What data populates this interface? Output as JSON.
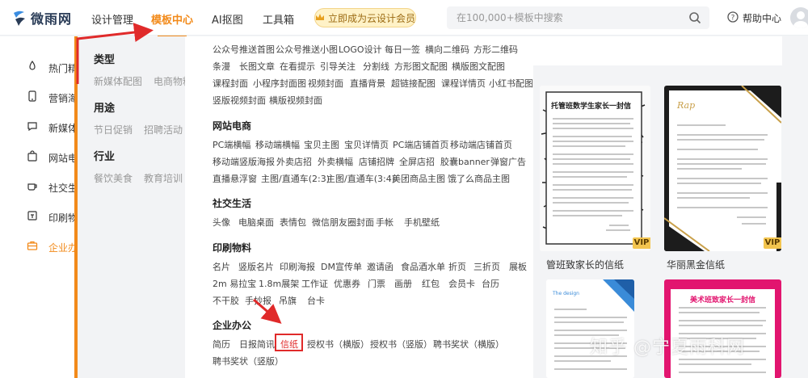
{
  "header": {
    "logo_text": "微雨网",
    "nav": [
      "设计管理",
      "模板中心",
      "AI抠图",
      "工具箱"
    ],
    "vip_label": "立即成为云设计会员",
    "search_placeholder": "在100,000+模板中搜索",
    "help_label": "帮助中心",
    "accent_color": "#f28a1a"
  },
  "sidebar": {
    "items": [
      "热门精选",
      "营销海报",
      "新媒体配图",
      "网站电商",
      "社交生活",
      "印刷物料",
      "企业办公"
    ]
  },
  "categories": {
    "type": {
      "title": "类型",
      "items": [
        "新媒体配图",
        "电商物料"
      ]
    },
    "usage": {
      "title": "用途",
      "items": [
        "节日促销",
        "招聘活动"
      ]
    },
    "industry": {
      "title": "行业",
      "items": [
        "餐饮美食",
        "教育培训"
      ]
    }
  },
  "menu": {
    "media_rows": [
      [
        "公众号推送首图",
        "公众号推送小图",
        "LOGO设计",
        "每日一签",
        "横向二维码",
        "方形二维码"
      ],
      [
        "条漫",
        "长图文章",
        "在看提示",
        "引导关注",
        "分割线",
        "方形图文配图",
        "横版图文配图"
      ],
      [
        "课程封面",
        "小程序封面图",
        "视频封面",
        "直播背景",
        "超链接配图",
        "课程详情页",
        "小红书配图"
      ],
      [
        "竖版视频封面",
        "横版视频封面"
      ]
    ],
    "ecommerce": {
      "title": "网站电商",
      "rows": [
        [
          "PC端横幅",
          "移动端横幅",
          "宝贝主图",
          "宝贝详情页",
          "PC端店铺首页",
          "移动端店铺首页"
        ],
        [
          "移动端竖版海报",
          "外卖店招",
          "外卖横幅",
          "店铺招牌",
          "全屏店招",
          "胶囊banner",
          "弹窗广告"
        ],
        [
          "直播悬浮窗",
          "主图/直通车(2:3)",
          "主图/直通车(3:4)",
          "美团商品主图",
          "饿了么商品主图"
        ]
      ]
    },
    "social": {
      "title": "社交生活",
      "rows": [
        [
          "头像",
          "电脑桌面",
          "表情包",
          "微信朋友圈封面",
          "手帐",
          "手机壁纸"
        ]
      ]
    },
    "print": {
      "title": "印刷物料",
      "rows": [
        [
          "名片",
          "竖版名片",
          "印刷海报",
          "DM宣传单",
          "邀请函",
          "食品酒水单",
          "折页",
          "三折页",
          "展板"
        ],
        [
          "2m 易拉宝",
          "1.8m展架",
          "工作证",
          "优惠券",
          "门票",
          "画册",
          "红包",
          "会员卡",
          "台历"
        ],
        [
          "不干胶",
          "手抄报",
          "吊旗",
          "台卡"
        ]
      ]
    },
    "office": {
      "title": "企业办公",
      "rows": [
        [
          "简历",
          "日报简讯",
          "信纸",
          "授权书（横版）",
          "授权书（竖版）",
          "聘书奖状（横版）"
        ],
        [
          "聘书奖状（竖版）"
        ]
      ],
      "highlighted": "信纸"
    }
  },
  "cards": {
    "card1_heading": "托管班数学生家长一封信",
    "card1_caption": "管班致家长的信纸",
    "card2_caption": "华丽黑金信纸",
    "card2_brand": "Rap",
    "card3_logo": "The design",
    "card4_heading": "美术班致家长一封信",
    "vip_tag": "VIP"
  },
  "watermark": "知乎 @宁夏雨科网"
}
